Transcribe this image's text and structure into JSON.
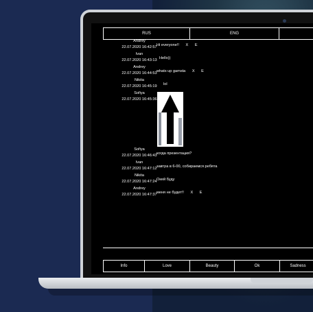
{
  "screen": {
    "lang_tabs": [
      "RUS",
      "ENG"
    ],
    "messages": [
      {
        "author": "Andrey",
        "time": "22.07.2020 16:42:57",
        "text": "Hi everyone!!",
        "actions": [
          "X",
          "E"
        ]
      },
      {
        "author": "Ivan",
        "time": "22.07.2020 16:43:13",
        "text": "Hello))",
        "actions": []
      },
      {
        "author": "Andrey",
        "time": "22.07.2020 16:44:53",
        "text": "whats up gamsta",
        "actions": [
          "X",
          "E"
        ]
      },
      {
        "author": "Nikita",
        "time": "22.07.2020 16:45:19",
        "text": "lol",
        "actions": []
      },
      {
        "author": "Sofiya",
        "time": "22.07.2020 16:45:36",
        "text": "",
        "actions": []
      },
      {
        "author": "Sofiya",
        "time": "22.07.2020 16:46:43",
        "text": "когда презентация?",
        "actions": []
      },
      {
        "author": "Ivan",
        "time": "22.07.2020 16:47:12",
        "text": "завтра в 6-00, собираемся ребята",
        "actions": []
      },
      {
        "author": "Nikita",
        "time": "22.07.2020 16:47:24",
        "text": "Окей буду",
        "actions": []
      },
      {
        "author": "Andrey",
        "time": "22.07.2020 16:47:37",
        "text": "меня не будет!!",
        "actions": [
          "X",
          "E"
        ]
      }
    ],
    "moods": [
      "Info",
      "Love",
      "Beauty",
      "Ok",
      "Sadness"
    ]
  },
  "icons": {
    "image_attachment": "up-arrow-icon"
  },
  "colors": {
    "background": "#1b2a52",
    "screen": "#000000",
    "text": "#ffffff"
  }
}
